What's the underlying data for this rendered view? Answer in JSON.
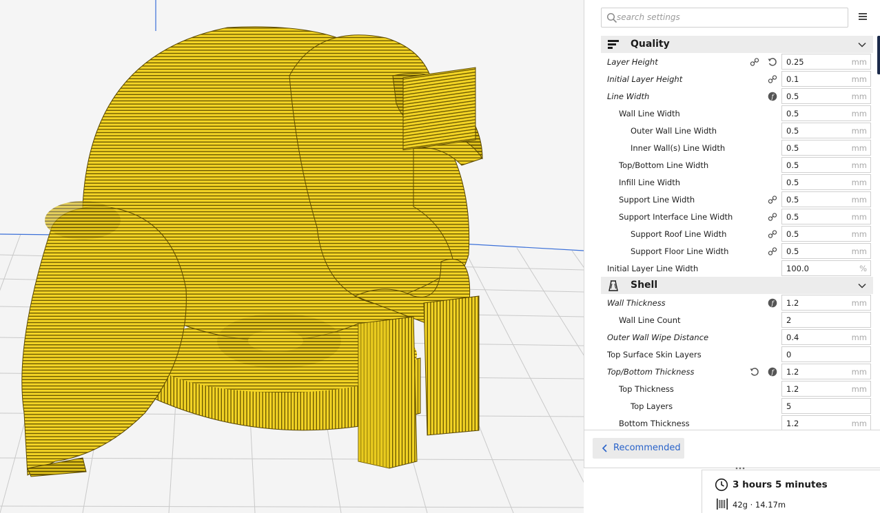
{
  "search": {
    "placeholder": "search settings"
  },
  "quality": {
    "title": "Quality",
    "rows": [
      {
        "label": "Layer Height",
        "value": "0.25",
        "unit": "mm"
      },
      {
        "label": "Initial Layer Height",
        "value": "0.1",
        "unit": "mm"
      },
      {
        "label": "Line Width",
        "value": "0.5",
        "unit": "mm"
      },
      {
        "label": "Wall Line Width",
        "value": "0.5",
        "unit": "mm"
      },
      {
        "label": "Outer Wall Line Width",
        "value": "0.5",
        "unit": "mm"
      },
      {
        "label": "Inner Wall(s) Line Width",
        "value": "0.5",
        "unit": "mm"
      },
      {
        "label": "Top/Bottom Line Width",
        "value": "0.5",
        "unit": "mm"
      },
      {
        "label": "Infill Line Width",
        "value": "0.5",
        "unit": "mm"
      },
      {
        "label": "Support Line Width",
        "value": "0.5",
        "unit": "mm"
      },
      {
        "label": "Support Interface Line Width",
        "value": "0.5",
        "unit": "mm"
      },
      {
        "label": "Support Roof Line Width",
        "value": "0.5",
        "unit": "mm"
      },
      {
        "label": "Support Floor Line Width",
        "value": "0.5",
        "unit": "mm"
      },
      {
        "label": "Initial Layer Line Width",
        "value": "100.0",
        "unit": "%"
      }
    ]
  },
  "shell": {
    "title": "Shell",
    "rows": [
      {
        "label": "Wall Thickness",
        "value": "1.2",
        "unit": "mm"
      },
      {
        "label": "Wall Line Count",
        "value": "2",
        "unit": ""
      },
      {
        "label": "Outer Wall Wipe Distance",
        "value": "0.4",
        "unit": "mm"
      },
      {
        "label": "Top Surface Skin Layers",
        "value": "0",
        "unit": ""
      },
      {
        "label": "Top/Bottom Thickness",
        "value": "1.2",
        "unit": "mm"
      },
      {
        "label": "Top Thickness",
        "value": "1.2",
        "unit": "mm"
      },
      {
        "label": "Top Layers",
        "value": "5",
        "unit": ""
      },
      {
        "label": "Bottom Thickness",
        "value": "1.2",
        "unit": "mm"
      }
    ]
  },
  "footer": {
    "recommended_label": "Recommended"
  },
  "print_info": {
    "time": "3 hours 5 minutes",
    "material": "42g · 14.17m"
  },
  "icons": {
    "link": "link-icon",
    "reset": "reset-icon",
    "function": "function-icon",
    "quality": "quality-icon",
    "shell": "shell-icon"
  },
  "colors": {
    "model": "#f2d61e",
    "accent": "#2862c9",
    "build_plate": "#f3f3f3"
  }
}
